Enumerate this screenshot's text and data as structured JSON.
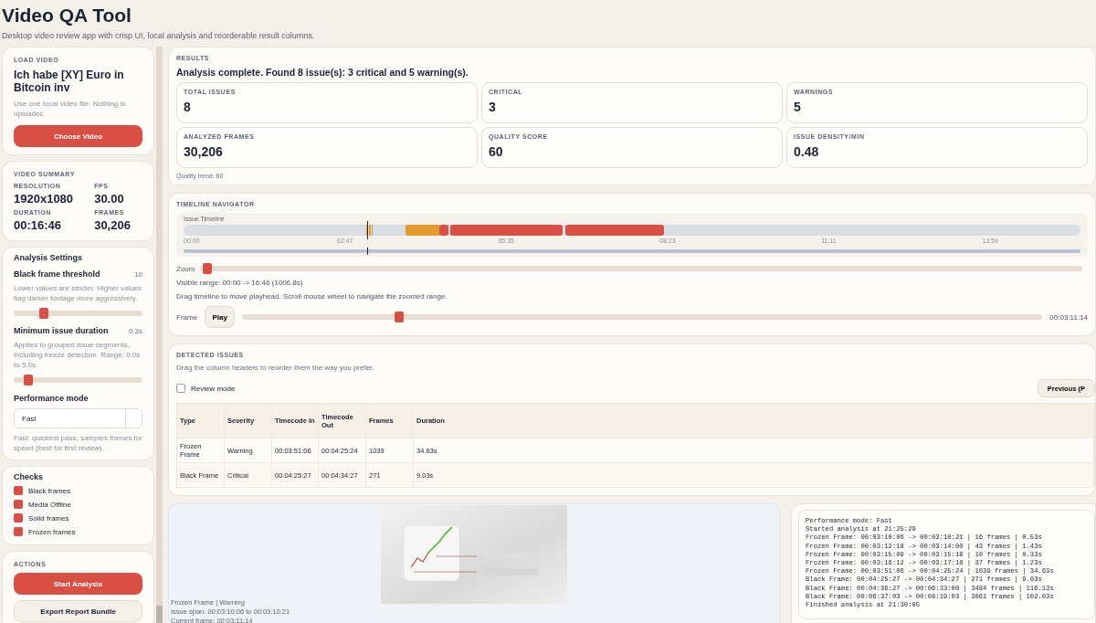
{
  "app": {
    "title": "Video QA Tool",
    "subtitle": "Desktop video review app with crisp UI, local analysis and reorderable result columns."
  },
  "load_video": {
    "heading": "LOAD VIDEO",
    "file_name": "Ich habe [XY] Euro in Bitcoin inv",
    "hint": "Use one local video file. Nothing is uploadec",
    "button": "Choose Video"
  },
  "video_summary": {
    "heading": "VIDEO SUMMARY",
    "fields": [
      {
        "label": "RESOLUTION",
        "value": "1920x1080"
      },
      {
        "label": "FPS",
        "value": "30.00"
      },
      {
        "label": "DURATION",
        "value": "00:16:46"
      },
      {
        "label": "FRAMES",
        "value": "30,206"
      }
    ]
  },
  "analysis_settings": {
    "heading": "Analysis Settings",
    "sliders": [
      {
        "label": "Black frame threshold",
        "reading": "10",
        "help": "Lower values are stricter. Higher values flag darker footage more aggressively.",
        "level": 0.2
      },
      {
        "label": "Minimum issue duration",
        "reading": "0.3s",
        "help": "Applies to grouped issue segments, including freeze detection. Range: 0.0s to 5.0s.",
        "level": 0.06
      }
    ],
    "performance_mode": {
      "label": "Performance mode",
      "value": "Fast",
      "help": "Fast: quickest pass, samples frames for speed (best for first review)."
    }
  },
  "checks": {
    "heading": "Checks",
    "items": [
      {
        "label": "Black frames",
        "checked": true
      },
      {
        "label": "Media Offline",
        "checked": true
      },
      {
        "label": "Solid frames",
        "checked": true
      },
      {
        "label": "Frozen frames",
        "checked": true
      }
    ]
  },
  "actions": {
    "heading": "ACTIONS",
    "buttons": [
      {
        "label": "Start Analysis",
        "kind": "primary"
      },
      {
        "label": "Export Report Bundle",
        "kind": "secondary"
      }
    ]
  },
  "results": {
    "heading": "RESULTS",
    "summary": "Analysis complete. Found 8 issue(s): 3 critical and 5 warning(s).",
    "stats": [
      {
        "label": "TOTAL ISSUES",
        "value": "8"
      },
      {
        "label": "CRITICAL",
        "value": "3"
      },
      {
        "label": "WARNINGS",
        "value": "5"
      },
      {
        "label": "ANALYZED FRAMES",
        "value": "30,206"
      },
      {
        "label": "QUALITY SCORE",
        "value": "60"
      },
      {
        "label": "ISSUE DENSITY/MIN",
        "value": "0.48"
      }
    ],
    "trend": "Quality trend: 60"
  },
  "timeline": {
    "heading": "TIMELINE NAVIGATOR",
    "track_label": "Issue Timeline",
    "ticks": [
      "00:00",
      "02:47",
      "05:35",
      "08:23",
      "11:11",
      "13:59"
    ],
    "zoom": {
      "label": "Zoom",
      "level": 0
    },
    "visible_range": "Visible range: 00:00 -> 16:46 (1006.8s)",
    "hint": "Drag timeline to move playhead. Scroll mouse wheel to navigate the zoomed range.",
    "frame": {
      "label": "Frame",
      "button": "Play",
      "level": 0.19,
      "time": "00:03:11:14"
    }
  },
  "issues": {
    "heading": "DETECTED ISSUES",
    "hint": "Drag the column headers to reorder them the way you prefer.",
    "review_mode": {
      "label": "Review mode",
      "checked": false
    },
    "previous_button": "Previous (P",
    "columns": [
      "Type",
      "Severity",
      "Timecode In",
      "Timecode Out",
      "Frames",
      "Duration"
    ],
    "rows": [
      [
        "Frozen Frame",
        "Warning",
        "00:03:51:06",
        "00:04:25:24",
        "1039",
        "34.63s"
      ],
      [
        "Black Frame",
        "Critical",
        "00:04:25:27",
        "00:04:34:27",
        "271",
        "9.03s"
      ]
    ]
  },
  "preview": {
    "picture": {
      "kind": "picture"
    },
    "captions": [
      "Frozen Frame | Warning",
      "Issue span: 00:03:10:06 to 00:03:10:21",
      "Current frame: 00:03:11:14"
    ]
  },
  "log": {
    "lines": [
      "Performance mode: Fast",
      "Started analysis at 21:25:29",
      "Frozen Frame: 00:03:10:06 -> 00:03:10:21 | 16 frames | 0.53s",
      "Frozen Frame: 00:03:12:18 -> 00:03:14:00 | 43 frames | 1.43s",
      "Frozen Frame: 00:03:15:09 -> 00:03:15:18 | 10 frames | 0.33s",
      "Frozen Frame: 00:03:16:12 -> 00:03:17:18 | 37 frames | 1.23s",
      "Frozen Frame: 00:03:51:06 -> 00:04:25:24 | 1039 frames | 34.63s",
      "Black Frame: 00:04:25:27 -> 00:04:34:27 | 271 frames | 9.03s",
      "Black Frame: 00:04:36:27 -> 00:06:33:00 | 3484 frames | 116.13s",
      "Black Frame: 00:06:37:03 -> 00:08:19:03 | 3061 frames | 102.03s",
      "Finished analysis at 21:30:05"
    ]
  }
}
